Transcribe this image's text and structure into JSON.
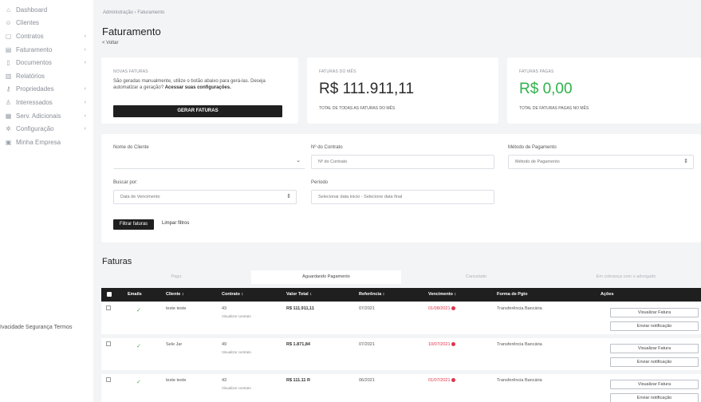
{
  "sidebar": {
    "items": [
      {
        "label": "Dashboard",
        "icon": "home-icon",
        "glyph": "⌂",
        "chev": ""
      },
      {
        "label": "Clientes",
        "icon": "user-icon",
        "glyph": "☺",
        "chev": ""
      },
      {
        "label": "Contratos",
        "icon": "document-icon",
        "glyph": "▢",
        "chev": "‹"
      },
      {
        "label": "Faturamento",
        "icon": "billing-icon",
        "glyph": "▤",
        "chev": "‹"
      },
      {
        "label": "Documentos",
        "icon": "file-icon",
        "glyph": "▯",
        "chev": "‹"
      },
      {
        "label": "Relatórios",
        "icon": "chart-icon",
        "glyph": "▥",
        "chev": ""
      },
      {
        "label": "Propriedades",
        "icon": "key-icon",
        "glyph": "⚷",
        "chev": "‹"
      },
      {
        "label": "Interessados",
        "icon": "people-icon",
        "glyph": "♙",
        "chev": "‹"
      },
      {
        "label": "Serv. Adicionais",
        "icon": "calendar-icon",
        "glyph": "▦",
        "chev": "‹"
      },
      {
        "label": "Configuração",
        "icon": "gear-icon",
        "glyph": "✲",
        "chev": "‹"
      },
      {
        "label": "Minha Empresa",
        "icon": "building-icon",
        "glyph": "▣",
        "chev": ""
      }
    ],
    "footer": "Ivacidade Segurança Termos"
  },
  "header": {
    "breadcrumb": "Administração › Faturamento",
    "title": "Faturamento",
    "back": "< Voltar"
  },
  "cards": {
    "novas": {
      "label": "NOVAS FATURAS",
      "text": "São geradas manualmente, utilize o botão abaixo para gerá-las. Deseja automatizar a geração?",
      "link": "Acessar suas configurações.",
      "button": "GERAR FATURAS"
    },
    "mes": {
      "label": "FATURAS DO MÊS",
      "value": "R$ 111.911,11",
      "sub": "TOTAL DE TODAS AS FATURAS DO MÊS"
    },
    "pagas": {
      "label": "FATURAS PAGAS",
      "value": "R$ 0,00",
      "sub": "TOTAL DE FATURAS PAGAS NO MÊS"
    }
  },
  "filters": {
    "cliente_label": "Nome do Cliente",
    "cliente_value": "",
    "contrato_label": "Nº do Contrato",
    "contrato_placeholder": "Nº do Contrato",
    "metodo_label": "Método de Pagamento",
    "metodo_placeholder": "Método de Pagamento",
    "buscar_label": "Buscar por:",
    "buscar_value": "Data de Vencimento",
    "periodo_label": "Período",
    "periodo_placeholder": "Selecionar data inicio - Selecione data final",
    "filtrar_button": "Filtrar faturas",
    "limpar_link": "Limpar filtros"
  },
  "faturas": {
    "title": "Faturas",
    "tabs": [
      "Pago",
      "Aguardando Pagamento",
      "Cancelado",
      "Em cobrança com o advogado"
    ],
    "active_tab": 1,
    "columns": [
      "Emails",
      "Cliente ↕",
      "Contrato ↕",
      "Valor Total ↕",
      "Referência ↕",
      "Vencimento ↕",
      "Forma de Pgto",
      "Ações"
    ],
    "rows": [
      {
        "cliente": "teste teste",
        "contrato": "43",
        "contrato_link": "Visualizar contrato",
        "valor": "R$ 111.911,11",
        "referencia": "07/2021",
        "vencimento": "01/08/2021",
        "forma": "Transferência Bancária"
      },
      {
        "cliente": "Sele Jar",
        "contrato": "49",
        "contrato_link": "Visualizar contrato",
        "valor": "R$ 1.871,84",
        "referencia": "07/2021",
        "vencimento": "10/07/2021",
        "forma": "Transferência Bancária"
      },
      {
        "cliente": "teste teste",
        "contrato": "43",
        "contrato_link": "Visualizar contrato",
        "valor": "R$ 111.11 R",
        "referencia": "06/2021",
        "vencimento": "01/07/2021",
        "forma": "Transferência Bancária"
      }
    ],
    "actions": {
      "view": "Visualizar Fatura",
      "notify": "Enviar notificação"
    }
  }
}
